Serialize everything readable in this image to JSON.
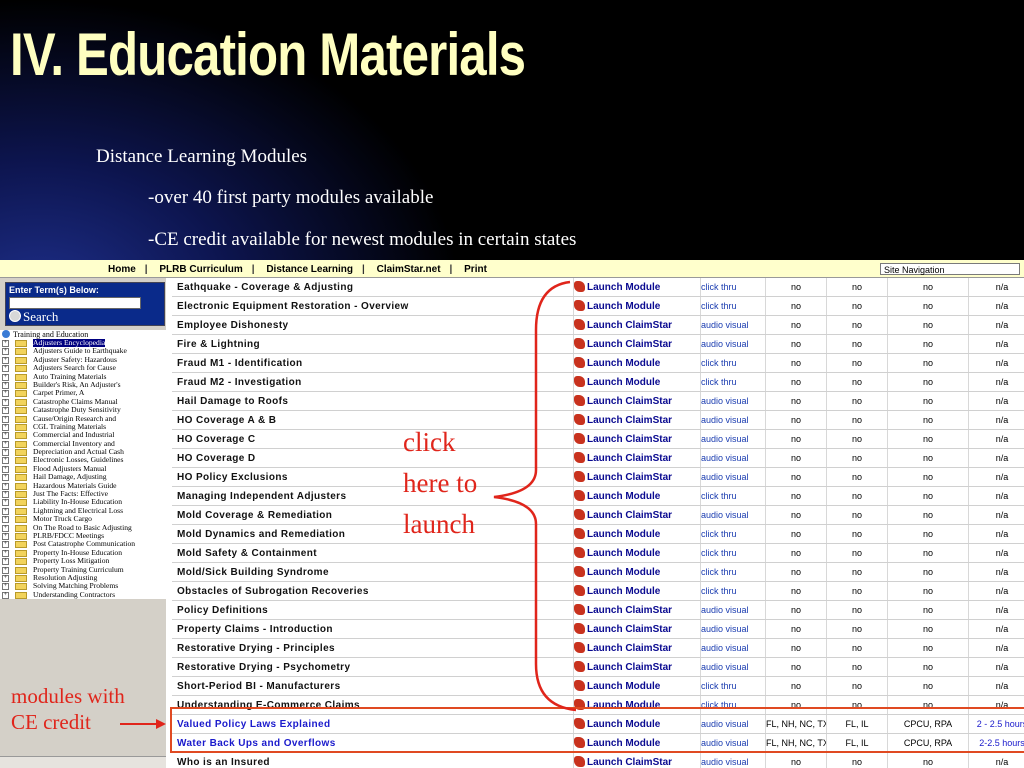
{
  "slide": {
    "title": "IV. Education Materials",
    "bullets": [
      "Distance Learning Modules",
      "-over 40 first party modules available",
      "-CE credit available for newest modules in certain states"
    ]
  },
  "nav": {
    "links": [
      "Home",
      "PLRB Curriculum",
      "Distance Learning",
      "ClaimStar.net",
      "Print"
    ],
    "site_navigation": "Site Navigation"
  },
  "search": {
    "label": "Enter Term(s) Below:",
    "placeholder": "",
    "button": "Search",
    "icon": "search-icon"
  },
  "tree": {
    "root": "Training and Education",
    "selected_index": 0,
    "items": [
      "Adjusters Encyclopedia",
      "Adjusters Guide to Earthquake",
      "Adjuster Safety: Hazardous",
      "Adjusters Search for Cause",
      "Auto Training Materials",
      "Builder's Risk, An Adjuster's",
      "Carpet Primer, A",
      "Catastrophe Claims Manual",
      "Catastrophe Duty Sensitivity",
      "Cause/Origin Research and",
      "CGL Training Materials",
      "Commercial and Industrial",
      "Commercial Inventory and",
      "Depreciation and Actual Cash",
      "Electronic Losses, Guidelines",
      "Flood Adjusters Manual",
      "Hail Damage, Adjusting",
      "Hazardous Materials Guide",
      "Just The Facts: Effective",
      "Liability In-House Education",
      "Lightning and Electrical Loss",
      "Motor Truck Cargo",
      "On The Road to Basic Adjusting",
      "PLRB/FDCC Meetings",
      "Post Catastrophe Communication",
      "Property In-House Education",
      "Property Loss Mitigation",
      "Property Training Curriculum",
      "Resolution Adjusting",
      "Solving Matching Problems",
      "Understanding Contractors"
    ]
  },
  "table": {
    "rows": [
      {
        "title": "Eathquake - Coverage & Adjusting",
        "launch": "Launch Module",
        "type": "click thru",
        "a": "no",
        "b": "no",
        "c": "no",
        "d": "n/a"
      },
      {
        "title": "Electronic Equipment Restoration - Overview",
        "launch": "Launch Module",
        "type": "click thru",
        "a": "no",
        "b": "no",
        "c": "no",
        "d": "n/a"
      },
      {
        "title": "Employee Dishonesty",
        "launch": "Launch ClaimStar",
        "type": "audio visual",
        "a": "no",
        "b": "no",
        "c": "no",
        "d": "n/a"
      },
      {
        "title": "Fire & Lightning",
        "launch": "Launch ClaimStar",
        "type": "audio visual",
        "a": "no",
        "b": "no",
        "c": "no",
        "d": "n/a"
      },
      {
        "title": "Fraud M1 - Identification",
        "launch": "Launch Module",
        "type": "click thru",
        "a": "no",
        "b": "no",
        "c": "no",
        "d": "n/a"
      },
      {
        "title": "Fraud M2 - Investigation",
        "launch": "Launch Module",
        "type": "click thru",
        "a": "no",
        "b": "no",
        "c": "no",
        "d": "n/a"
      },
      {
        "title": "Hail Damage to Roofs",
        "launch": "Launch ClaimStar",
        "type": "audio visual",
        "a": "no",
        "b": "no",
        "c": "no",
        "d": "n/a"
      },
      {
        "title": "HO Coverage A & B",
        "launch": "Launch ClaimStar",
        "type": "audio visual",
        "a": "no",
        "b": "no",
        "c": "no",
        "d": "n/a"
      },
      {
        "title": "HO Coverage C",
        "launch": "Launch ClaimStar",
        "type": "audio visual",
        "a": "no",
        "b": "no",
        "c": "no",
        "d": "n/a"
      },
      {
        "title": "HO Coverage D",
        "launch": "Launch ClaimStar",
        "type": "audio visual",
        "a": "no",
        "b": "no",
        "c": "no",
        "d": "n/a"
      },
      {
        "title": "HO Policy Exclusions",
        "launch": "Launch ClaimStar",
        "type": "audio visual",
        "a": "no",
        "b": "no",
        "c": "no",
        "d": "n/a"
      },
      {
        "title": "Managing Independent Adjusters",
        "launch": "Launch Module",
        "type": "click thru",
        "a": "no",
        "b": "no",
        "c": "no",
        "d": "n/a"
      },
      {
        "title": "Mold Coverage & Remediation",
        "launch": "Launch ClaimStar",
        "type": "audio visual",
        "a": "no",
        "b": "no",
        "c": "no",
        "d": "n/a"
      },
      {
        "title": "Mold Dynamics and Remediation",
        "launch": "Launch Module",
        "type": "click thru",
        "a": "no",
        "b": "no",
        "c": "no",
        "d": "n/a"
      },
      {
        "title": "Mold Safety & Containment",
        "launch": "Launch Module",
        "type": "click thru",
        "a": "no",
        "b": "no",
        "c": "no",
        "d": "n/a"
      },
      {
        "title": "Mold/Sick Building Syndrome",
        "launch": "Launch Module",
        "type": "click thru",
        "a": "no",
        "b": "no",
        "c": "no",
        "d": "n/a"
      },
      {
        "title": "Obstacles of Subrogation Recoveries",
        "launch": "Launch Module",
        "type": "click thru",
        "a": "no",
        "b": "no",
        "c": "no",
        "d": "n/a"
      },
      {
        "title": "Policy Definitions",
        "launch": "Launch ClaimStar",
        "type": "audio visual",
        "a": "no",
        "b": "no",
        "c": "no",
        "d": "n/a"
      },
      {
        "title": "Property Claims - Introduction",
        "launch": "Launch ClaimStar",
        "type": "audio visual",
        "a": "no",
        "b": "no",
        "c": "no",
        "d": "n/a"
      },
      {
        "title": "Restorative Drying - Principles",
        "launch": "Launch ClaimStar",
        "type": "audio visual",
        "a": "no",
        "b": "no",
        "c": "no",
        "d": "n/a"
      },
      {
        "title": "Restorative Drying - Psychometry",
        "launch": "Launch ClaimStar",
        "type": "audio visual",
        "a": "no",
        "b": "no",
        "c": "no",
        "d": "n/a"
      },
      {
        "title": "Short-Period BI - Manufacturers",
        "launch": "Launch Module",
        "type": "click thru",
        "a": "no",
        "b": "no",
        "c": "no",
        "d": "n/a"
      },
      {
        "title": "Understanding E-Commerce Claims",
        "launch": "Launch Module",
        "type": "click thru",
        "a": "no",
        "b": "no",
        "c": "no",
        "d": "n/a"
      },
      {
        "title": "Valued Policy Laws Explained",
        "launch": "Launch Module",
        "type": "audio visual",
        "a": "FL, NH, NC, TX",
        "b": "FL, IL",
        "c": "CPCU, RPA",
        "d": "2 - 2.5 hours",
        "highlight": true
      },
      {
        "title": "Water Back Ups and Overflows",
        "launch": "Launch Module",
        "type": "audio visual",
        "a": "FL, NH, NC, TX",
        "b": "FL, IL",
        "c": "CPCU, RPA",
        "d": "2-2.5 hours",
        "highlight": true
      },
      {
        "title": "Who is an Insured",
        "launch": "Launch ClaimStar",
        "type": "audio visual",
        "a": "no",
        "b": "no",
        "c": "no",
        "d": "n/a"
      }
    ]
  },
  "annotations": {
    "click_here": [
      "click",
      "here to",
      "launch"
    ],
    "modules_ce": [
      "modules with",
      "CE credit"
    ],
    "color": "#e0251b"
  }
}
